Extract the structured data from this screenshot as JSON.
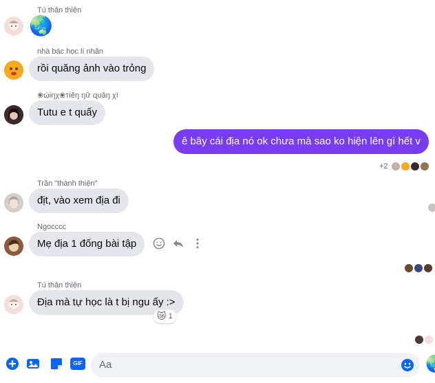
{
  "messages": [
    {
      "sender": "Tú thân thiện",
      "text": "🌏"
    },
    {
      "sender": "nhà bác học lí nhân",
      "text": "rồi quăng ảnh vào trỏng"
    },
    {
      "sender": "❀ώίŋχ❀тίêŋ ŋữ զυăŋ χì",
      "text": "Tutu e t quấy"
    },
    {
      "sender": "",
      "text": "ê bây cái địa nó ok chưa mà sao ko hiện lên gì hết v"
    },
    {
      "sender": "Trần \"thánh thiện\"",
      "text": "địt, vào xem địa đi"
    },
    {
      "sender": "Ngocccc",
      "text": "Mẹ địa 1 đống bài tập"
    },
    {
      "sender": "Tú thân thiện",
      "text": "Địa mà tự học là t bị ngu ấy :>",
      "reaction": {
        "emoji": "😿",
        "count": "1"
      }
    }
  ],
  "seen_more_count": "+2",
  "composer": {
    "placeholder": "Aa",
    "gif_label": "GIF",
    "emoji_icon": "🌏"
  },
  "colors": {
    "accent": "#0866ff",
    "own_bubble": "#7a3cf2",
    "other_bubble": "#e4e6eb"
  }
}
